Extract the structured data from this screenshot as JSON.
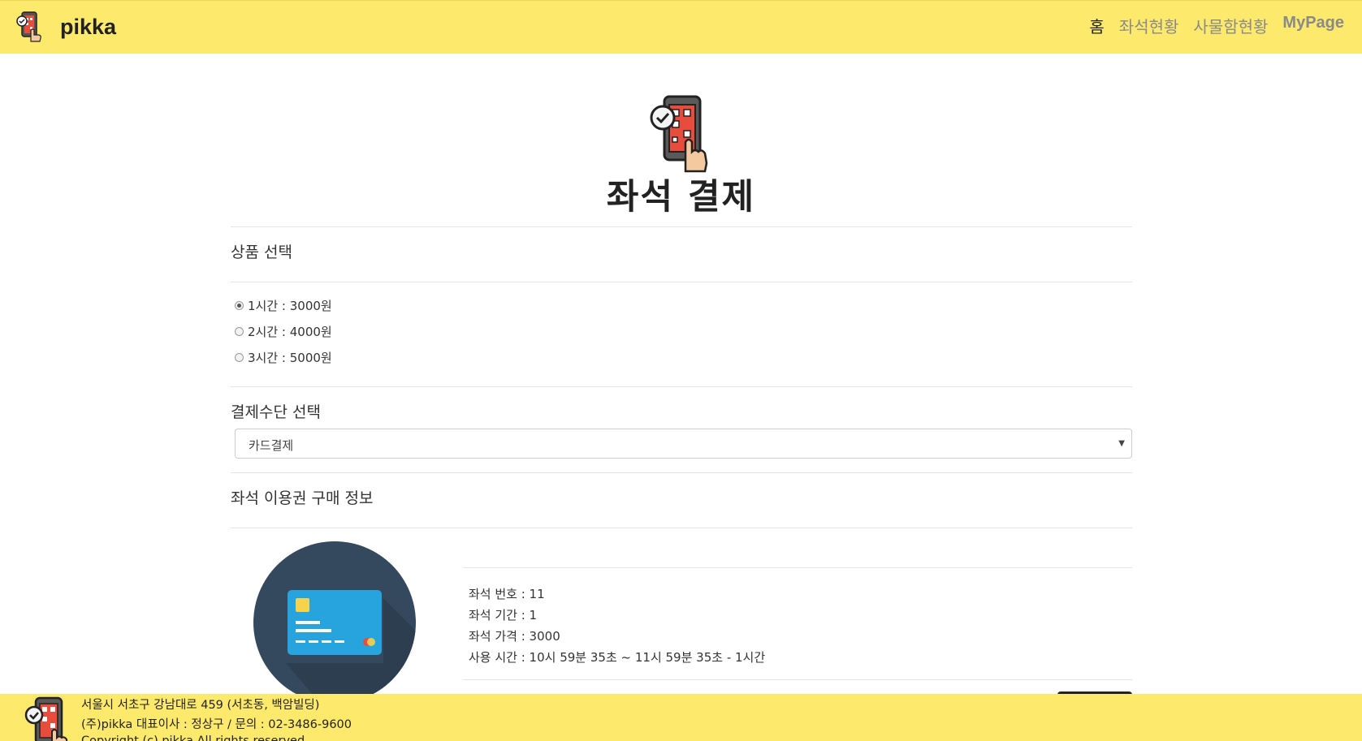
{
  "navbar": {
    "brand": "pikka",
    "links": [
      "홈",
      "좌석현황",
      "사물함현황",
      "MyPage"
    ]
  },
  "page": {
    "title": "좌석 결제"
  },
  "product": {
    "label": "상품 선택",
    "options": [
      "1시간 : 3000원",
      "2시간 : 4000원",
      "3시간 : 5000원"
    ],
    "selected_index": 0
  },
  "payment": {
    "label": "결제수단 선택",
    "selected": "카드결제"
  },
  "purchase": {
    "label": "좌석 이용권 구매 정보",
    "lines": [
      "좌석 번호 : 11",
      "좌석 기간 : 1",
      "좌석 가격 : 3000",
      "사용 시간 : 10시 59분 35초  ~ 11시 59분 35초  - 1시간"
    ]
  },
  "footer": {
    "lines": [
      "서울시 서초구 강남대로 459 (서초동, 백암빌딩)",
      "(주)pikka 대표이사 : 정상구 / 문의 : 02-3486-9600",
      "Copyright (c) pikka All rights reserved."
    ]
  },
  "colors": {
    "brand_yellow": "#fde96b",
    "card_circle": "#34495e",
    "card_blue": "#27a3dd"
  },
  "icons": {
    "logo": "phone-qr-hand-icon",
    "payment": "credit-card-icon"
  }
}
